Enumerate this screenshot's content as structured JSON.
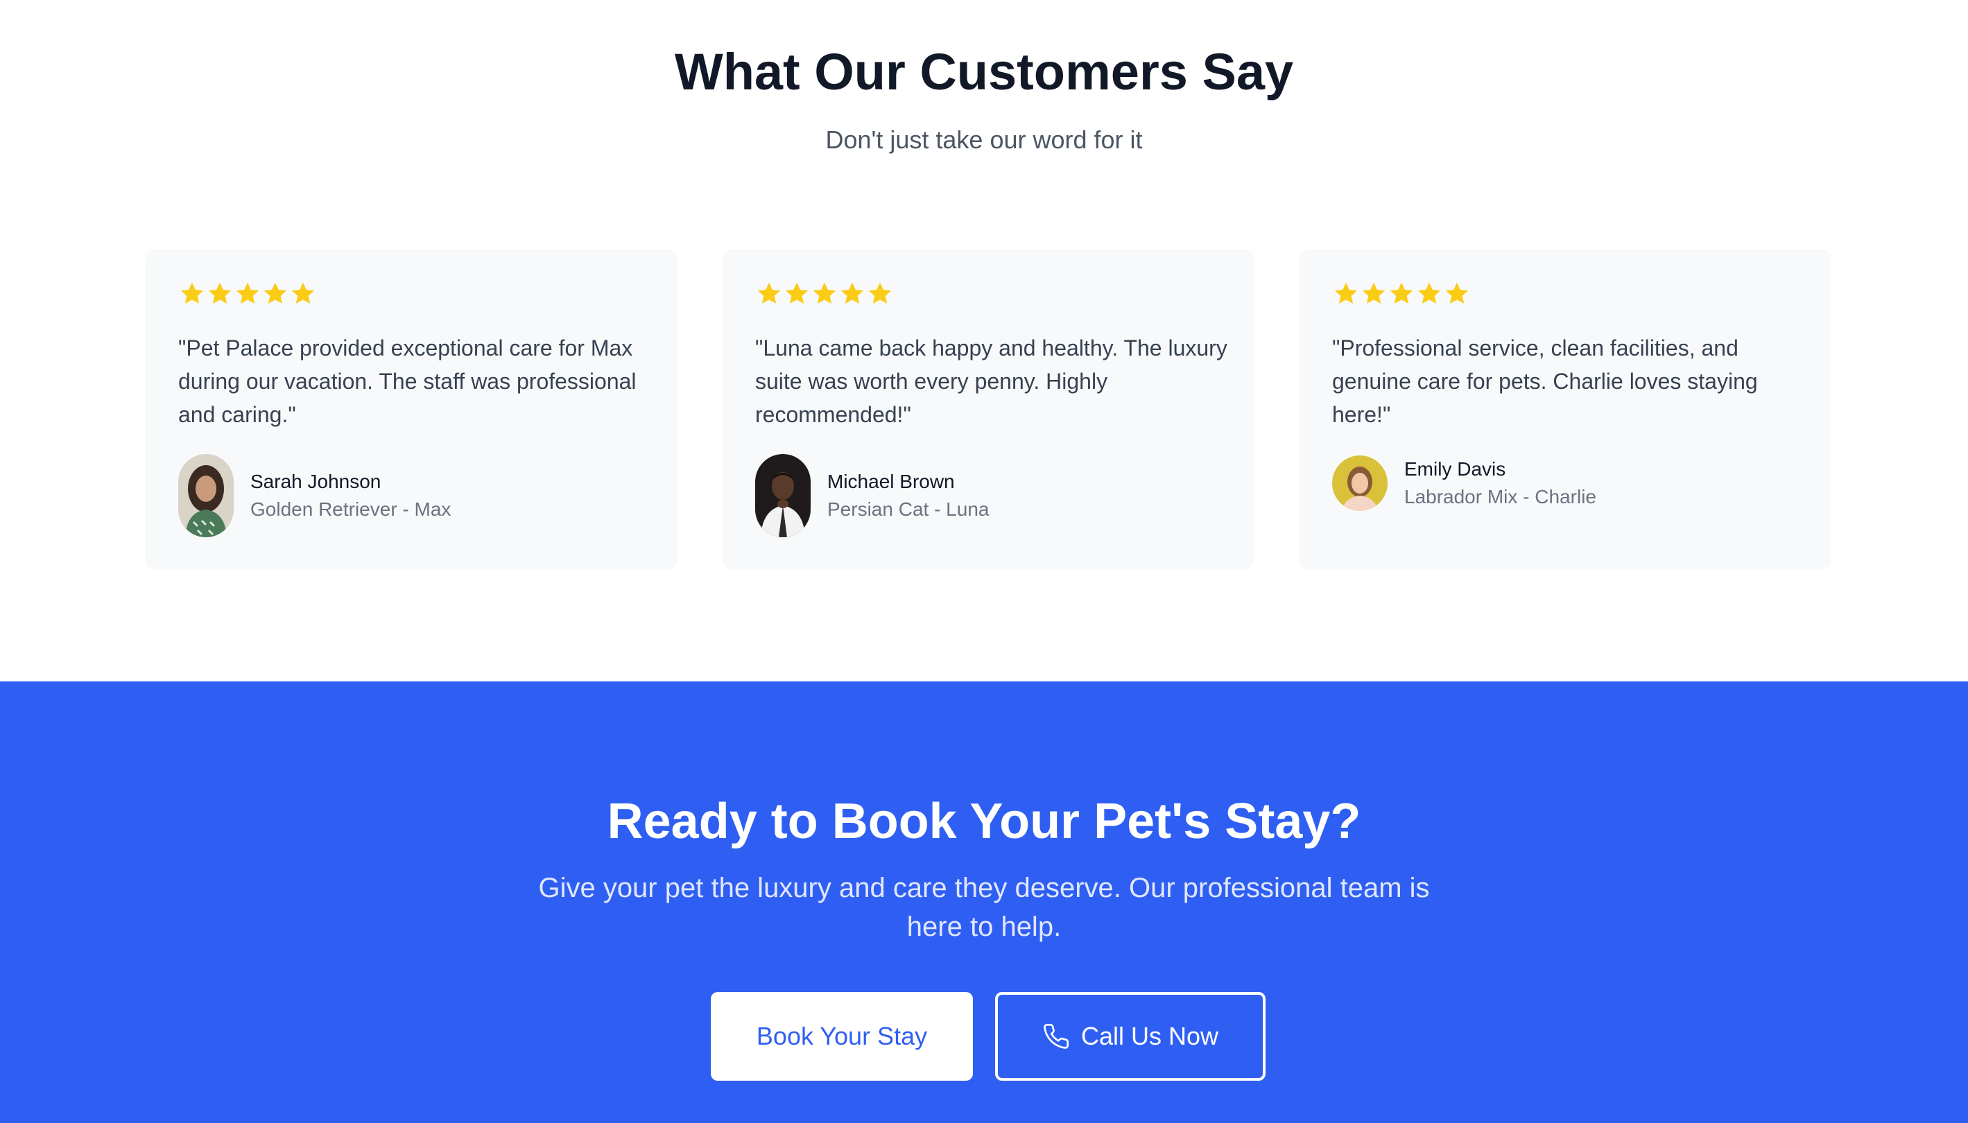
{
  "testimonials": {
    "title": "What Our Customers Say",
    "subtitle": "Don't just take our word for it",
    "star_color": "#facc15",
    "reviews": [
      {
        "rating": 5,
        "quote": "\"Pet Palace provided exceptional care for Max during our vacation. The staff was professional and caring.\"",
        "name": "Sarah Johnson",
        "pet": "Golden Retriever - Max"
      },
      {
        "rating": 5,
        "quote": "\"Luna came back happy and healthy. The luxury suite was worth every penny. Highly recommended!\"",
        "name": "Michael Brown",
        "pet": "Persian Cat - Luna"
      },
      {
        "rating": 5,
        "quote": "\"Professional service, clean facilities, and genuine care for pets. Charlie loves staying here!\"",
        "name": "Emily Davis",
        "pet": "Labrador Mix - Charlie"
      }
    ]
  },
  "cta": {
    "title": "Ready to Book Your Pet's Stay?",
    "text": "Give your pet the luxury and care they deserve. Our professional team is here to help.",
    "primary_button": "Book Your Stay",
    "secondary_button": "Call Us Now",
    "secondary_icon": "phone-icon",
    "background_color": "#2f5ff2"
  }
}
